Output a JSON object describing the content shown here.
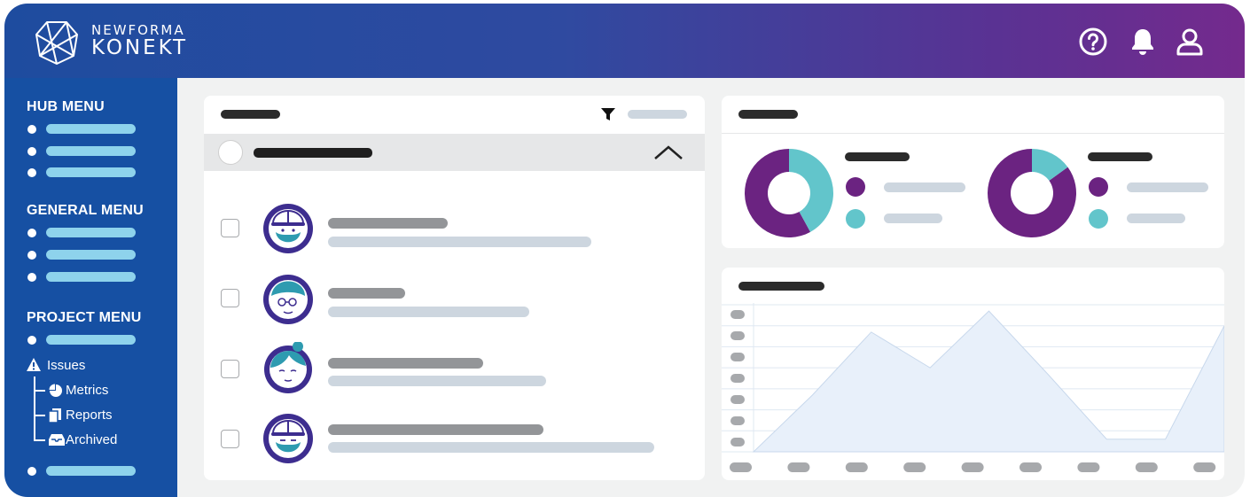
{
  "brand": {
    "line1": "NEWFORMA",
    "line2": "KONEKT"
  },
  "header_icons": [
    "help-icon",
    "bell-icon",
    "user-icon"
  ],
  "colors": {
    "header_left": "#1e4c9f",
    "header_right": "#742a8d",
    "sidebar": "#1650a3",
    "menu_bar": "#8ed3ec",
    "purple": "#6b2381",
    "teal": "#62c5cb",
    "chart_fill": "#e8f0fa",
    "chart_line": "#c8d8ec"
  },
  "sidebar": {
    "hub_menu": {
      "title": "HUB MENU"
    },
    "general_menu": {
      "title": "GENERAL MENU"
    },
    "project_menu": {
      "title": "PROJECT MENU",
      "issues": {
        "label": "Issues",
        "children": [
          {
            "label": "Metrics",
            "icon": "pie-chart-icon"
          },
          {
            "label": "Reports",
            "icon": "documents-icon"
          },
          {
            "label": "Archived",
            "icon": "inbox-icon"
          }
        ]
      }
    }
  },
  "chart_data": [
    {
      "type": "pie",
      "series": [
        {
          "values": [
            58,
            42
          ]
        }
      ],
      "colors": [
        "#6b2381",
        "#62c5cb"
      ]
    },
    {
      "type": "pie",
      "series": [
        {
          "values": [
            85,
            15
          ]
        }
      ],
      "colors": [
        "#6b2381",
        "#62c5cb"
      ]
    },
    {
      "type": "area",
      "x": [
        1,
        2,
        3,
        4,
        5,
        6,
        7,
        8,
        9
      ],
      "series": [
        {
          "values": [
            0,
            2.7,
            5.7,
            4.0,
            6.7,
            3.7,
            0.6,
            0.6,
            6.0
          ]
        }
      ],
      "ylim": [
        0,
        7
      ],
      "grid": true
    }
  ]
}
